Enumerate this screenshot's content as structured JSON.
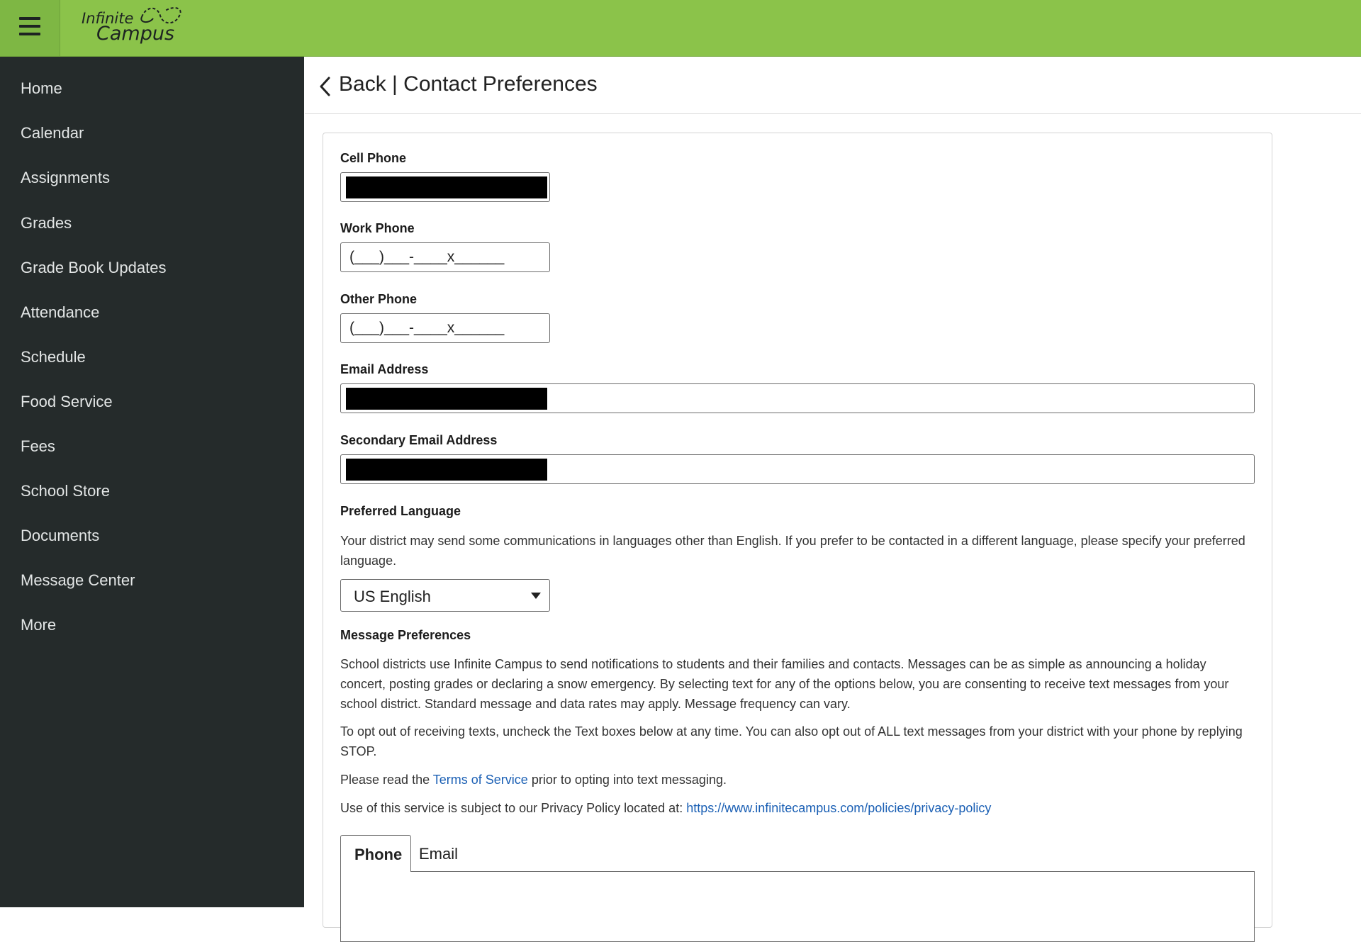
{
  "app": {
    "logo_line1": "Infinite",
    "logo_line2": "Campus"
  },
  "sidebar": {
    "items": [
      {
        "label": "Home"
      },
      {
        "label": "Calendar"
      },
      {
        "label": "Assignments"
      },
      {
        "label": "Grades"
      },
      {
        "label": "Grade Book Updates"
      },
      {
        "label": "Attendance"
      },
      {
        "label": "Schedule"
      },
      {
        "label": "Food Service"
      },
      {
        "label": "Fees"
      },
      {
        "label": "School Store"
      },
      {
        "label": "Documents"
      },
      {
        "label": "Message Center"
      },
      {
        "label": "More"
      }
    ]
  },
  "header": {
    "back_label": "Back | Contact Preferences"
  },
  "form": {
    "cell_phone_label": "Cell Phone",
    "work_phone_label": "Work Phone",
    "work_phone_value": "(___)___-____x______",
    "other_phone_label": "Other Phone",
    "other_phone_value": "(___)___-____x______",
    "email_label": "Email Address",
    "secondary_email_label": "Secondary Email Address",
    "preferred_language_label": "Preferred Language",
    "preferred_language_text": "Your district may send some communications in languages other than English. If you prefer to be contacted in a different language, please specify your preferred language.",
    "language_selected": "US English",
    "message_prefs_label": "Message Preferences",
    "message_prefs_text": "School districts use Infinite Campus to send notifications to students and their families and contacts. Messages can be as simple as announcing a holiday concert, posting grades or declaring a snow emergency. By selecting text for any of the options below, you are consenting to receive text messages from your school district. Standard message and data rates may apply. Message frequency can vary.",
    "opt_out_text": "To opt out of receiving texts, uncheck the Text boxes below at any time. You can also opt out of ALL text messages from your district with your phone by replying STOP.",
    "terms_prefix": "Please read the ",
    "terms_link": "Terms of Service",
    "terms_suffix": " prior to opting into text messaging.",
    "privacy_prefix": "Use of this service is subject to our Privacy Policy located at: ",
    "privacy_link": "https://www.infinitecampus.com/policies/privacy-policy"
  },
  "tabs": [
    {
      "label": "Phone",
      "active": true
    },
    {
      "label": "Email",
      "active": false
    }
  ],
  "colors": {
    "topbar": "#8bc34a",
    "sidebar": "#252b2b",
    "link": "#1a5fb4"
  }
}
